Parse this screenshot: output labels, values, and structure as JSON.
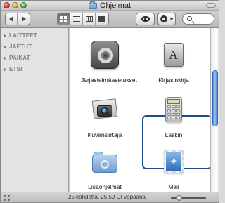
{
  "window": {
    "title": "Ohjelmat"
  },
  "sidebar": {
    "sections": [
      {
        "label": "LAITTEET"
      },
      {
        "label": "JAETUT"
      },
      {
        "label": "PAIKAT"
      },
      {
        "label": "ETSI"
      }
    ]
  },
  "toolbar": {
    "nav": {
      "back_icon": "back-arrow-icon",
      "forward_icon": "forward-arrow-icon"
    },
    "view_modes": [
      {
        "name": "icon-view",
        "active": true
      },
      {
        "name": "list-view",
        "active": false
      },
      {
        "name": "column-view",
        "active": false
      },
      {
        "name": "cover-flow-view",
        "active": false
      }
    ],
    "quick_look_icon": "eye-icon",
    "action_icon": "gear-icon",
    "search": {
      "placeholder": ""
    }
  },
  "items": [
    {
      "label": "Järjestelmäasetukset",
      "icon": "system-preferences-icon",
      "selected": false
    },
    {
      "label": "Kirjasinkirja",
      "icon": "font-book-icon",
      "selected": false
    },
    {
      "label": "Kuvansiirtäjä",
      "icon": "image-capture-icon",
      "selected": true
    },
    {
      "label": "Laskin",
      "icon": "calculator-icon",
      "selected": false
    },
    {
      "label": "Lisäohjelmat",
      "icon": "utilities-folder-icon",
      "selected": false
    },
    {
      "label": "Mail",
      "icon": "mail-icon",
      "selected": false
    }
  ],
  "status_bar": {
    "text": "25 kohdetta, 25.59 Gt vapaana",
    "zoom_level": 0.2
  },
  "colors": {
    "selection": "#1f4d8a",
    "sidebar_text": "#7a7f8a"
  }
}
